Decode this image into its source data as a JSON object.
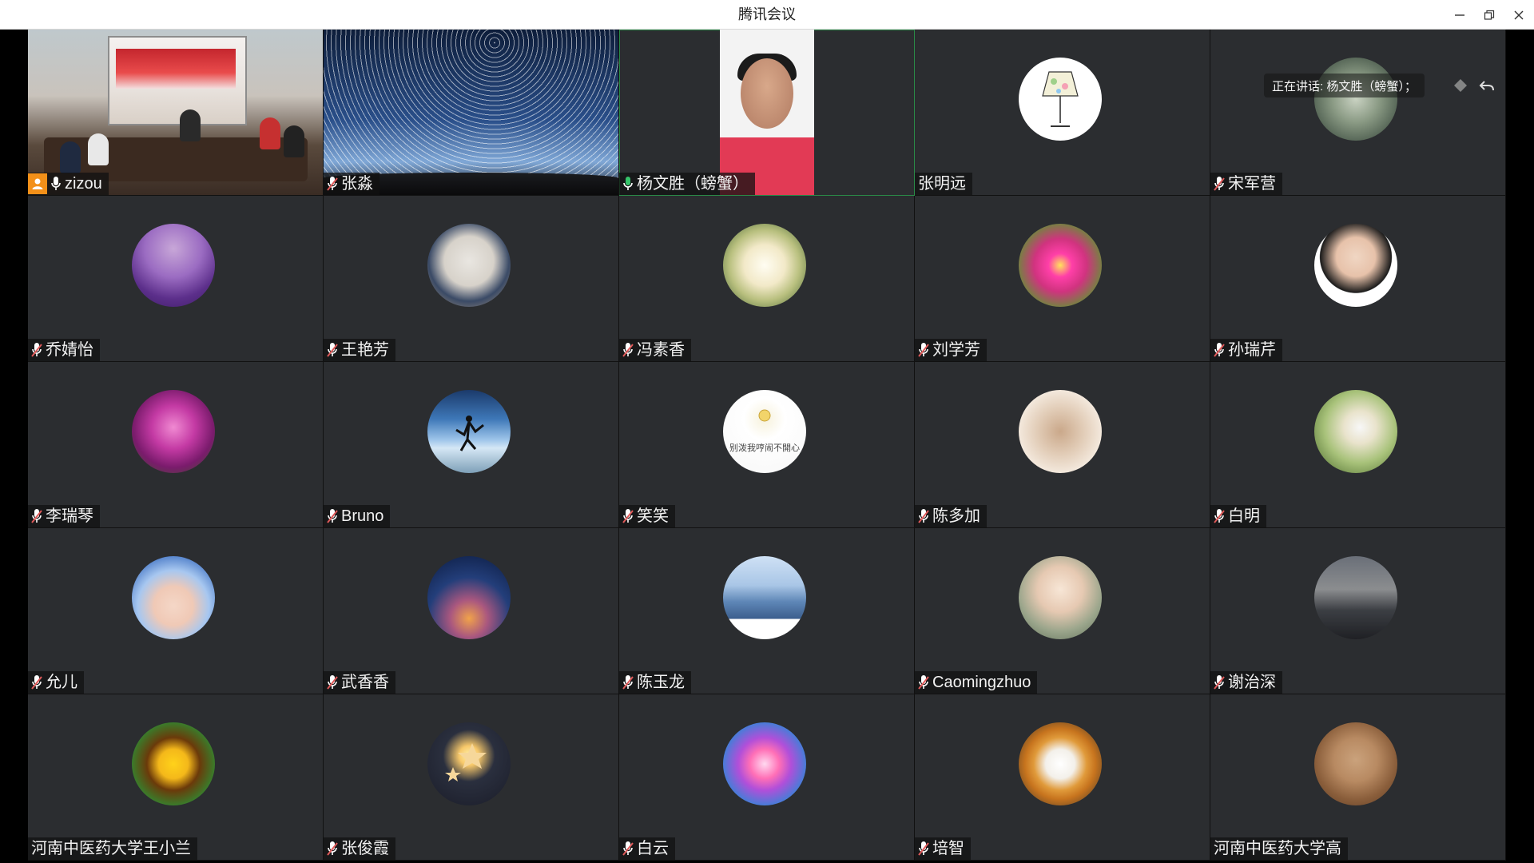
{
  "window": {
    "title": "腾讯会议"
  },
  "speaking_banner": {
    "label": "正在讲话: 杨文胜（螃蟹）；"
  },
  "participants": [
    {
      "name": "zizou"
    },
    {
      "name": "张淼"
    },
    {
      "name": "杨文胜（螃蟹）"
    },
    {
      "name": "张明远"
    },
    {
      "name": "宋军营"
    },
    {
      "name": "乔婧怡"
    },
    {
      "name": "王艳芳"
    },
    {
      "name": "冯素香"
    },
    {
      "name": "刘学芳"
    },
    {
      "name": "孙瑞芹"
    },
    {
      "name": "李瑞琴"
    },
    {
      "name": "Bruno"
    },
    {
      "name": "笑笑"
    },
    {
      "name": "陈多加"
    },
    {
      "name": "白明"
    },
    {
      "name": "允儿"
    },
    {
      "name": "武香香"
    },
    {
      "name": "陈玉龙"
    },
    {
      "name": "Caomingzhuo"
    },
    {
      "name": "谢治深"
    },
    {
      "name": "河南中医药大学王小兰"
    },
    {
      "name": "张俊霞"
    },
    {
      "name": "白云"
    },
    {
      "name": "培智"
    },
    {
      "name": "河南中医药大学高"
    }
  ],
  "avatar_texts": {
    "xiaoxiao": "别泼我哼闹不開心"
  },
  "colors": {
    "tile_bg": "#2b2d30",
    "active_border": "#2a8a47",
    "host_orange": "#f39019",
    "mic_red": "#e05a5a",
    "mic_green": "#36c36a"
  }
}
